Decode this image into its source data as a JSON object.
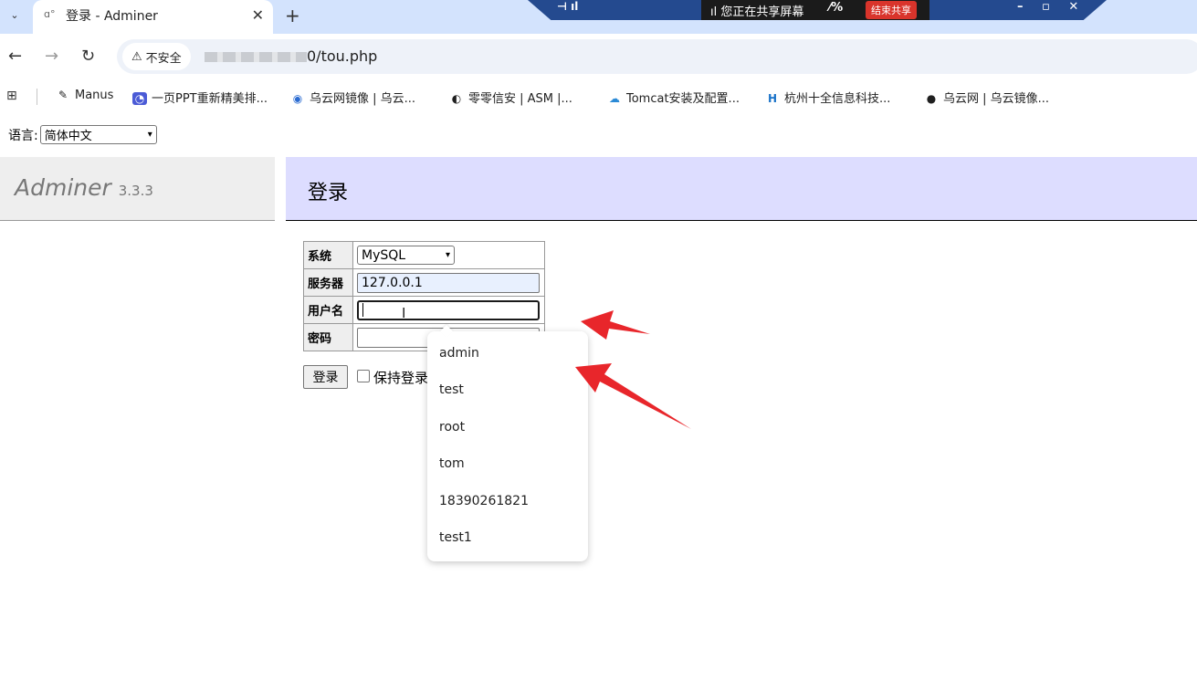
{
  "browser": {
    "tab_title": "登录 - Adminer",
    "new_tab_symbol": "+",
    "close_symbol": "✕",
    "address_security_label": "不安全",
    "address_url": "0/tou.php",
    "bookmarks": [
      {
        "icon": "manus-icon",
        "label": "Manus"
      },
      {
        "icon": "ppt-icon",
        "label": "一页PPT重新精美排..."
      },
      {
        "icon": "eye-icon",
        "label": "乌云网镜像 | 乌云..."
      },
      {
        "icon": "circle-icon",
        "label": "零零信安 | ASM |..."
      },
      {
        "icon": "cloud-icon",
        "label": "Tomcat安装及配置..."
      },
      {
        "icon": "h-logo-icon",
        "label": "杭州十全信息科技..."
      },
      {
        "icon": "globe-icon",
        "label": "乌云网 | 乌云镜像..."
      }
    ]
  },
  "share_bar": {
    "sharing_text": "您正在共享屏幕",
    "end_label": "结束共享",
    "accent": "#d9342b",
    "bar_color": "#244a8f"
  },
  "page": {
    "language_label": "语言:",
    "language_value": "简体中文",
    "app_name": "Adminer",
    "app_version": "3.3.3",
    "title": "登录",
    "form": {
      "system_label": "系统",
      "system_value": "MySQL",
      "server_label": "服务器",
      "server_value": "127.0.0.1",
      "username_label": "用户名",
      "username_value": "",
      "password_label": "密码",
      "password_value": "",
      "login_button": "登录",
      "permanent_label": "保持登录"
    },
    "autocomplete_options": [
      "admin",
      "test",
      "root",
      "tom",
      "18390261821",
      "test1"
    ],
    "annotation_color": "#e8262b"
  }
}
